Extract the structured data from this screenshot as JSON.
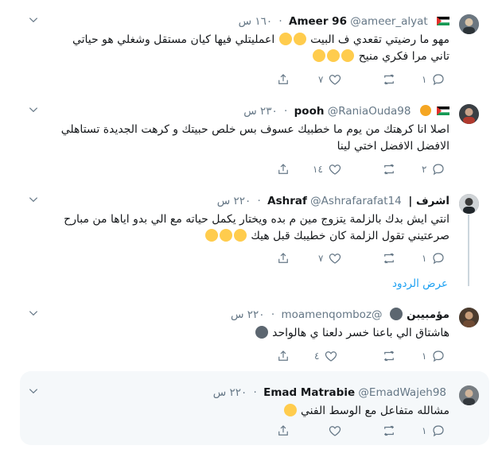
{
  "tweets": [
    {
      "name": "Ameer 96",
      "handle": "@ameer_alyat",
      "time": "١٦٠ س",
      "text": "مهو ما رضيتي تقعدي ف البيت",
      "text_mid": "اعمليتلي فيها كيان مستقل وشغلي هو حياتي",
      "text2": "تاني مرا فكري منيح",
      "replies": "١",
      "likes": "٧",
      "avatar_color": "#6b7680"
    },
    {
      "name": "pooh",
      "handle": "@RaniaOuda98",
      "time": "٢٣٠ س",
      "text": "اصلا انا كرهتك من يوم ما خطبيك عسوف بس خلص حبيتك و كرهت الجديدة تستاهلي",
      "text2": "الافضل الافضل اختي لينا",
      "replies": "٢",
      "likes": "١٤",
      "avatar_color": "#8a6a5a"
    },
    {
      "name": "اشرف | Ashraf",
      "handle": "@Ashrafarafat14",
      "time": "٢٢٠ س",
      "text": "انتي ايش بدك بالزلمة يتزوج مين م بده ويختار يكمل حياته مع الي بدو اياها من مبارح",
      "text2": "صرعتيني تقول الزلمة كان خطيبك قبل هيك",
      "replies": "١",
      "likes": "٧",
      "show_replies": "عرض الردود",
      "avatar_color": "#55606a"
    },
    {
      "name": "مؤمبيبن",
      "handle": "@moamenqomboz",
      "time": "٢٢٠ س",
      "text": "هاشتاق الي باعنا خسر دلعنا ي هالواحد",
      "replies": "١",
      "likes": "٤",
      "avatar_color": "#6a5a4a"
    },
    {
      "name": "Emad Matrabie",
      "handle": "@EmadWajeh98",
      "time": "٢٢٠ س",
      "text": "مشالله متفاعل مع الوسط الفني",
      "replies": "١",
      "likes": "",
      "avatar_color": "#777d82"
    }
  ],
  "colors": {
    "accent": "#1da1f2",
    "muted": "#657786",
    "hover_bg": "#f5f8fa",
    "thread_line": "#ccd6dd"
  },
  "icons": {
    "reply": "reply-icon",
    "retweet": "retweet-icon",
    "like": "heart-icon",
    "share": "share-icon",
    "more": "chevron-down-icon"
  }
}
